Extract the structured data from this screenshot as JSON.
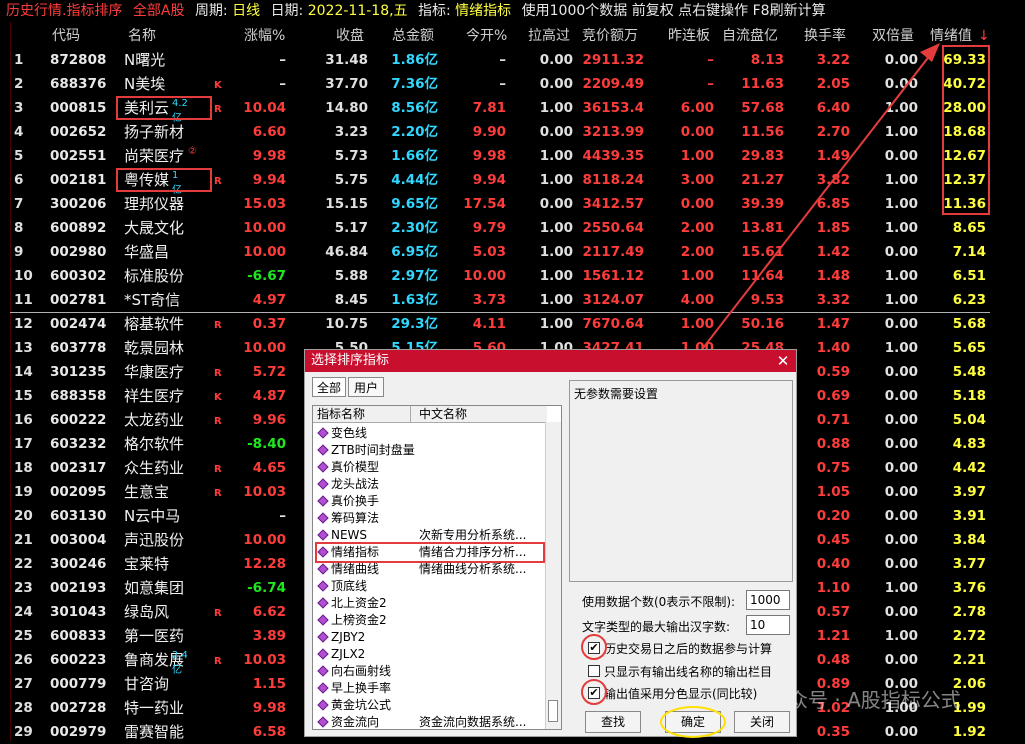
{
  "topbar": {
    "title": "历史行情.指标排序",
    "filter": "全部A股",
    "period_label": "周期:",
    "period_value": "日线",
    "date_label": "日期:",
    "date_value": "2022-11-18,五",
    "indicator_label": "指标:",
    "indicator_value": "情绪指标",
    "hint": "使用1000个数据 前复权 点右键操作 F8刷新计算"
  },
  "columns": [
    "代码",
    "名称",
    "涨幅%",
    "收盘",
    "总金额",
    "今开%",
    "拉高过",
    "竞价额万",
    "昨连板",
    "自流盘亿",
    "换手率",
    "双倍量",
    "情绪值"
  ],
  "sort_arrow": "↓",
  "rows": [
    {
      "idx": "1",
      "code": "872808",
      "name": "N曙光",
      "chg": "–",
      "close": "31.48",
      "amt": "1.86亿",
      "open": "–",
      "lift": "0.00",
      "bid": "2911.32",
      "prev": "–",
      "float": "8.13",
      "turn": "3.22",
      "dbl": "0.00",
      "emo": "69.33",
      "chg_color": "num",
      "open_color": "num",
      "flag": ""
    },
    {
      "idx": "2",
      "code": "688376",
      "name": "N美埃",
      "chg": "–",
      "close": "37.70",
      "amt": "7.36亿",
      "open": "–",
      "lift": "0.00",
      "bid": "2209.49",
      "prev": "–",
      "float": "11.63",
      "turn": "2.05",
      "dbl": "0.00",
      "emo": "40.72",
      "chg_color": "num",
      "open_color": "num",
      "flag": "K"
    },
    {
      "idx": "3",
      "code": "000815",
      "name": "美利云",
      "chg": "10.04",
      "close": "14.80",
      "amt": "8.56亿",
      "open": "7.81",
      "lift": "1.00",
      "bid": "36153.4",
      "prev": "6.00",
      "float": "57.68",
      "turn": "6.40",
      "dbl": "1.00",
      "emo": "28.00",
      "chg_color": "red",
      "open_color": "red",
      "flag": "R",
      "suffix": "4.2亿"
    },
    {
      "idx": "4",
      "code": "002652",
      "name": "扬子新材",
      "chg": "6.60",
      "close": "3.23",
      "amt": "2.20亿",
      "open": "9.90",
      "lift": "0.00",
      "bid": "3213.99",
      "prev": "0.00",
      "float": "11.56",
      "turn": "2.70",
      "dbl": "1.00",
      "emo": "18.68",
      "chg_color": "red",
      "open_color": "red",
      "flag": ""
    },
    {
      "idx": "5",
      "code": "002551",
      "name": "尚荣医疗",
      "chg": "9.98",
      "close": "5.73",
      "amt": "1.66亿",
      "open": "9.98",
      "lift": "1.00",
      "bid": "4439.35",
      "prev": "1.00",
      "float": "29.83",
      "turn": "1.49",
      "dbl": "0.00",
      "emo": "12.67",
      "chg_color": "red",
      "open_color": "red",
      "flag": "",
      "suffix": "②"
    },
    {
      "idx": "6",
      "code": "002181",
      "name": "粤传媒",
      "chg": "9.94",
      "close": "5.75",
      "amt": "4.44亿",
      "open": "9.94",
      "lift": "1.00",
      "bid": "8118.24",
      "prev": "3.00",
      "float": "21.27",
      "turn": "3.82",
      "dbl": "1.00",
      "emo": "12.37",
      "chg_color": "red",
      "open_color": "red",
      "flag": "R",
      "suffix": "1亿"
    },
    {
      "idx": "7",
      "code": "300206",
      "name": "理邦仪器",
      "chg": "15.03",
      "close": "15.15",
      "amt": "9.65亿",
      "open": "17.54",
      "lift": "0.00",
      "bid": "3412.57",
      "prev": "0.00",
      "float": "39.39",
      "turn": "6.85",
      "dbl": "1.00",
      "emo": "11.36",
      "chg_color": "red",
      "open_color": "red",
      "flag": ""
    },
    {
      "idx": "8",
      "code": "600892",
      "name": "大晟文化",
      "chg": "10.00",
      "close": "5.17",
      "amt": "2.30亿",
      "open": "9.79",
      "lift": "1.00",
      "bid": "2550.64",
      "prev": "2.00",
      "float": "13.81",
      "turn": "1.85",
      "dbl": "1.00",
      "emo": "8.65",
      "chg_color": "red",
      "open_color": "red",
      "flag": ""
    },
    {
      "idx": "9",
      "code": "002980",
      "name": "华盛昌",
      "chg": "10.00",
      "close": "46.84",
      "amt": "6.95亿",
      "open": "5.03",
      "lift": "1.00",
      "bid": "2117.49",
      "prev": "2.00",
      "float": "15.61",
      "turn": "1.42",
      "dbl": "0.00",
      "emo": "7.14",
      "chg_color": "red",
      "open_color": "red",
      "flag": ""
    },
    {
      "idx": "10",
      "code": "600302",
      "name": "标准股份",
      "chg": "-6.67",
      "close": "5.88",
      "amt": "2.97亿",
      "open": "10.00",
      "lift": "1.00",
      "bid": "1561.12",
      "prev": "1.00",
      "float": "11.64",
      "turn": "1.48",
      "dbl": "1.00",
      "emo": "6.51",
      "chg_color": "green",
      "open_color": "red",
      "flag": ""
    },
    {
      "idx": "11",
      "code": "002781",
      "name": "*ST奇信",
      "chg": "4.97",
      "close": "8.45",
      "amt": "1.63亿",
      "open": "3.73",
      "lift": "1.00",
      "bid": "3124.07",
      "prev": "4.00",
      "float": "9.53",
      "turn": "3.32",
      "dbl": "1.00",
      "emo": "6.23",
      "chg_color": "red",
      "open_color": "red",
      "flag": ""
    },
    {
      "idx": "12",
      "code": "002474",
      "name": "榕基软件",
      "chg": "0.37",
      "close": "10.75",
      "amt": "29.3亿",
      "open": "4.11",
      "lift": "1.00",
      "bid": "7670.64",
      "prev": "1.00",
      "float": "50.16",
      "turn": "1.47",
      "dbl": "0.00",
      "emo": "5.68",
      "chg_color": "red",
      "open_color": "red",
      "flag": "R"
    },
    {
      "idx": "13",
      "code": "603778",
      "name": "乾景园林",
      "chg": "10.00",
      "close": "5.50",
      "amt": "5.15亿",
      "open": "5.60",
      "lift": "1.00",
      "bid": "3427.41",
      "prev": "1.00",
      "float": "25.48",
      "turn": "1.40",
      "dbl": "1.00",
      "emo": "5.65",
      "chg_color": "red",
      "open_color": "red",
      "flag": ""
    },
    {
      "idx": "14",
      "code": "301235",
      "name": "华康医疗",
      "chg": "5.72",
      "close": "",
      "amt": "",
      "open": "",
      "lift": "",
      "bid": "",
      "prev": "",
      "float": "",
      "turn": "0.59",
      "dbl": "0.00",
      "emo": "5.48",
      "chg_color": "red",
      "open_color": "red",
      "flag": "R"
    },
    {
      "idx": "15",
      "code": "688358",
      "name": "祥生医疗",
      "chg": "4.87",
      "close": "",
      "amt": "",
      "open": "",
      "lift": "",
      "bid": "",
      "prev": "",
      "float": "",
      "turn": "0.69",
      "dbl": "0.00",
      "emo": "5.18",
      "chg_color": "red",
      "open_color": "red",
      "flag": "K"
    },
    {
      "idx": "16",
      "code": "600222",
      "name": "太龙药业",
      "chg": "9.96",
      "close": "",
      "amt": "",
      "open": "",
      "lift": "",
      "bid": "",
      "prev": "",
      "float": "",
      "turn": "0.71",
      "dbl": "0.00",
      "emo": "5.04",
      "chg_color": "red",
      "open_color": "red",
      "flag": "R"
    },
    {
      "idx": "17",
      "code": "603232",
      "name": "格尔软件",
      "chg": "-8.40",
      "close": "",
      "amt": "",
      "open": "",
      "lift": "",
      "bid": "",
      "prev": "",
      "float": "",
      "turn": "0.88",
      "dbl": "0.00",
      "emo": "4.83",
      "chg_color": "green",
      "open_color": "red",
      "flag": ""
    },
    {
      "idx": "18",
      "code": "002317",
      "name": "众生药业",
      "chg": "4.65",
      "close": "",
      "amt": "",
      "open": "",
      "lift": "",
      "bid": "",
      "prev": "",
      "float": "",
      "turn": "0.75",
      "dbl": "0.00",
      "emo": "4.42",
      "chg_color": "red",
      "open_color": "red",
      "flag": "R"
    },
    {
      "idx": "19",
      "code": "002095",
      "name": "生意宝",
      "chg": "10.03",
      "close": "",
      "amt": "",
      "open": "",
      "lift": "",
      "bid": "",
      "prev": "",
      "float": "",
      "turn": "1.05",
      "dbl": "0.00",
      "emo": "3.97",
      "chg_color": "red",
      "open_color": "red",
      "flag": "R"
    },
    {
      "idx": "20",
      "code": "603130",
      "name": "N云中马",
      "chg": "–",
      "close": "",
      "amt": "",
      "open": "",
      "lift": "",
      "bid": "",
      "prev": "",
      "float": "",
      "turn": "0.20",
      "dbl": "0.00",
      "emo": "3.91",
      "chg_color": "num",
      "open_color": "num",
      "flag": ""
    },
    {
      "idx": "21",
      "code": "003004",
      "name": "声迅股份",
      "chg": "10.00",
      "close": "",
      "amt": "",
      "open": "",
      "lift": "",
      "bid": "",
      "prev": "",
      "float": "",
      "turn": "0.45",
      "dbl": "0.00",
      "emo": "3.84",
      "chg_color": "red",
      "open_color": "red",
      "flag": ""
    },
    {
      "idx": "22",
      "code": "300246",
      "name": "宝莱特",
      "chg": "12.28",
      "close": "",
      "amt": "",
      "open": "",
      "lift": "",
      "bid": "",
      "prev": "",
      "float": "",
      "turn": "0.40",
      "dbl": "0.00",
      "emo": "3.77",
      "chg_color": "red",
      "open_color": "red",
      "flag": ""
    },
    {
      "idx": "23",
      "code": "002193",
      "name": "如意集团",
      "chg": "-6.74",
      "close": "",
      "amt": "",
      "open": "",
      "lift": "",
      "bid": "",
      "prev": "",
      "float": "",
      "turn": "1.10",
      "dbl": "1.00",
      "emo": "3.76",
      "chg_color": "green",
      "open_color": "red",
      "flag": ""
    },
    {
      "idx": "24",
      "code": "301043",
      "name": "绿岛风",
      "chg": "6.62",
      "close": "",
      "amt": "",
      "open": "",
      "lift": "",
      "bid": "",
      "prev": "",
      "float": "",
      "turn": "0.57",
      "dbl": "0.00",
      "emo": "2.78",
      "chg_color": "red",
      "open_color": "red",
      "flag": "R"
    },
    {
      "idx": "25",
      "code": "600833",
      "name": "第一医药",
      "chg": "3.89",
      "close": "",
      "amt": "",
      "open": "",
      "lift": "",
      "bid": "",
      "prev": "",
      "float": "",
      "turn": "1.21",
      "dbl": "1.00",
      "emo": "2.72",
      "chg_color": "red",
      "open_color": "red",
      "flag": ""
    },
    {
      "idx": "26",
      "code": "600223",
      "name": "鲁商发展",
      "chg": "10.03",
      "close": "",
      "amt": "",
      "open": "",
      "lift": "",
      "bid": "",
      "prev": "",
      "float": "",
      "turn": "0.48",
      "dbl": "0.00",
      "emo": "2.21",
      "chg_color": "red",
      "open_color": "red",
      "flag": "R",
      "suffix": "2.4亿"
    },
    {
      "idx": "27",
      "code": "000779",
      "name": "甘咨询",
      "chg": "1.15",
      "close": "",
      "amt": "",
      "open": "",
      "lift": "",
      "bid": "",
      "prev": "",
      "float": "",
      "turn": "0.89",
      "dbl": "0.00",
      "emo": "2.06",
      "chg_color": "red",
      "open_color": "red",
      "flag": ""
    },
    {
      "idx": "28",
      "code": "002728",
      "name": "特一药业",
      "chg": "9.98",
      "close": "",
      "amt": "",
      "open": "",
      "lift": "",
      "bid": "",
      "prev": "",
      "float": "",
      "turn": "1.02",
      "dbl": "1.00",
      "emo": "1.99",
      "chg_color": "red",
      "open_color": "red",
      "flag": ""
    },
    {
      "idx": "29",
      "code": "002979",
      "name": "雷赛智能",
      "chg": "6.58",
      "close": "",
      "amt": "",
      "open": "",
      "lift": "",
      "bid": "",
      "prev": "",
      "float": "",
      "turn": "0.35",
      "dbl": "0.00",
      "emo": "1.92",
      "chg_color": "red",
      "open_color": "red",
      "flag": ""
    }
  ],
  "dialog": {
    "title": "选择排序指标",
    "close": "✕",
    "tab_all": "全部",
    "tab_user": "用户",
    "col_name": "指标名称",
    "col_cn": "中文名称",
    "items": [
      {
        "name": "变色线",
        "cn": ""
      },
      {
        "name": "ZTB时间封盘量",
        "cn": ""
      },
      {
        "name": "真价模型",
        "cn": ""
      },
      {
        "name": "龙头战法",
        "cn": ""
      },
      {
        "name": "真价换手",
        "cn": ""
      },
      {
        "name": "筹码算法",
        "cn": ""
      },
      {
        "name": "NEWS",
        "cn": "次新专用分析系统..."
      },
      {
        "name": "情绪指标",
        "cn": "情绪合力排序分析..."
      },
      {
        "name": "情绪曲线",
        "cn": "情绪曲线分析系统..."
      },
      {
        "name": "顶底线",
        "cn": ""
      },
      {
        "name": "北上资金2",
        "cn": ""
      },
      {
        "name": "上榜资金2",
        "cn": ""
      },
      {
        "name": "ZJBY2",
        "cn": ""
      },
      {
        "name": "ZJLX2",
        "cn": ""
      },
      {
        "name": "向右画射线",
        "cn": ""
      },
      {
        "name": "早上换手率",
        "cn": ""
      },
      {
        "name": "黄金坑公式",
        "cn": ""
      },
      {
        "name": "资金流向",
        "cn": "资金流向数据系统..."
      }
    ],
    "no_param": "无参数需要设置",
    "data_count_label": "使用数据个数(0表示不限制):",
    "data_count_value": "1000",
    "max_chars_label": "文字类型的最大输出汉字数:",
    "max_chars_value": "10",
    "chk1": "历史交易日之后的数据参与计算",
    "chk2": "只显示有输出线名称的输出栏目",
    "chk3": "输出值采用分色显示(同比较)",
    "btn_find": "查找",
    "btn_ok": "确定",
    "btn_close": "关闭"
  },
  "watermark": "公众号 · A股指标公式"
}
